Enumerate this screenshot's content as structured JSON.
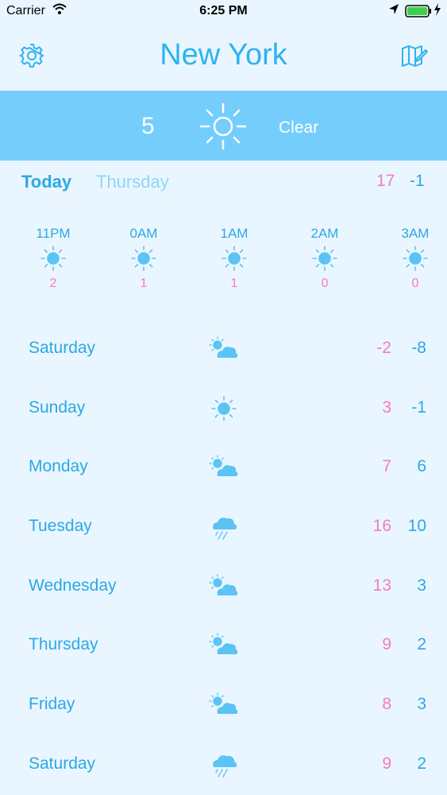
{
  "status_bar": {
    "carrier": "Carrier",
    "time": "6:25 PM",
    "icons": [
      "wifi-icon",
      "location-arrow-icon",
      "battery-icon",
      "charging-bolt-icon"
    ]
  },
  "header": {
    "title": "New York",
    "left_icon": "settings-gear-icon",
    "right_icon": "edit-map-icon"
  },
  "current": {
    "temperature": "5",
    "condition": "Clear",
    "icon": "sun-icon"
  },
  "today": {
    "label": "Today",
    "weekday": "Thursday",
    "high": "17",
    "low": "-1"
  },
  "hourly": [
    {
      "time": "11PM",
      "temp": "2",
      "icon": "sun-icon"
    },
    {
      "time": "0AM",
      "temp": "1",
      "icon": "sun-icon"
    },
    {
      "time": "1AM",
      "temp": "1",
      "icon": "sun-icon"
    },
    {
      "time": "2AM",
      "temp": "0",
      "icon": "sun-icon"
    },
    {
      "time": "3AM",
      "temp": "0",
      "icon": "sun-icon"
    }
  ],
  "daily": [
    {
      "day": "Saturday",
      "icon": "partly-cloudy-icon",
      "high": "-2",
      "low": "-8"
    },
    {
      "day": "Sunday",
      "icon": "sun-icon",
      "high": "3",
      "low": "-1"
    },
    {
      "day": "Monday",
      "icon": "partly-cloudy-icon",
      "high": "7",
      "low": "6"
    },
    {
      "day": "Tuesday",
      "icon": "rain-cloud-icon",
      "high": "16",
      "low": "10"
    },
    {
      "day": "Wednesday",
      "icon": "partly-cloudy-icon",
      "high": "13",
      "low": "3"
    },
    {
      "day": "Thursday",
      "icon": "partly-cloudy-icon",
      "high": "9",
      "low": "2"
    },
    {
      "day": "Friday",
      "icon": "partly-cloudy-icon",
      "high": "8",
      "low": "3"
    },
    {
      "day": "Saturday",
      "icon": "rain-cloud-icon",
      "high": "9",
      "low": "2"
    }
  ],
  "colors": {
    "accent": "#2ba8e6",
    "banner": "#75cdfc",
    "high_temp": "#f57ac0",
    "background": "#eaf6ff"
  }
}
